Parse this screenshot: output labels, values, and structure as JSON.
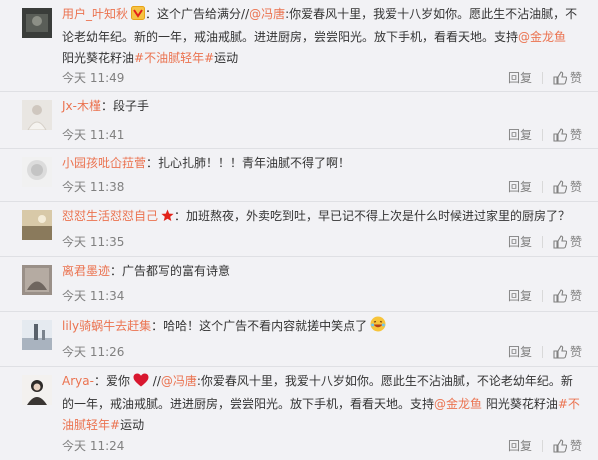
{
  "comments": [
    {
      "user": "用户_叶知秋",
      "separator": "：",
      "segments": [
        {
          "t": "这个广告给满分//",
          "k": "text"
        },
        {
          "t": "@冯唐",
          "k": "link"
        },
        {
          "t": ":你爱春风十里，我爱十八岁如你。愿此生不沾油腻，不论老幼年纪。新的一年，戒油戒腻。进进厨房，尝尝阳光。放下手机，看看天地。支持",
          "k": "text"
        },
        {
          "t": "@金龙鱼",
          "k": "link"
        },
        {
          "t": " 阳光葵花籽油",
          "k": "text"
        },
        {
          "t": "#不油腻轻年#",
          "k": "link"
        },
        {
          "t": "运动",
          "k": "text"
        }
      ],
      "time": "今天 11:49",
      "reply": "回复",
      "like": "赞"
    },
    {
      "user": "Jx-木槿",
      "separator": "：",
      "segments": [
        {
          "t": "段子手",
          "k": "text"
        }
      ],
      "time": "今天 11:41",
      "reply": "回复",
      "like": "赞"
    },
    {
      "user": "小园孩吡仚菈菅",
      "separator": "：",
      "segments": [
        {
          "t": "扎心扎肺！！！青年油腻不得了啊！",
          "k": "text"
        }
      ],
      "time": "今天 11:38",
      "reply": "回复",
      "like": "赞"
    },
    {
      "user": "怼怼生活怼怼自己",
      "separator": "：",
      "segments": [
        {
          "t": "加班熬夜，外卖吃到吐，早已记不得上次是什么时候进过家里的厨房了？",
          "k": "text"
        }
      ],
      "time": "今天 11:35",
      "reply": "回复",
      "like": "赞"
    },
    {
      "user": "离君墨迹",
      "separator": "：",
      "segments": [
        {
          "t": "广告都写的富有诗意",
          "k": "text"
        }
      ],
      "time": "今天 11:34",
      "reply": "回复",
      "like": "赞"
    },
    {
      "user": "lily骑蜗牛去赶集",
      "separator": "：",
      "segments": [
        {
          "t": "哈哈！这个广告不看内容就搓中笑点了",
          "k": "text"
        }
      ],
      "time": "今天 11:26",
      "reply": "回复",
      "like": "赞"
    },
    {
      "user": "Arya-",
      "separator": "：",
      "segments": [
        {
          "t": "爱你",
          "k": "text"
        },
        {
          "t": " //",
          "k": "text"
        },
        {
          "t": "@冯唐",
          "k": "link"
        },
        {
          "t": ":你爱春风十里，我爱十八岁如你。愿此生不沾油腻，不论老幼年纪。新的一年，戒油戒腻。进进厨房，尝尝阳光。放下手机，看看天地。支持",
          "k": "text"
        },
        {
          "t": "@金龙鱼",
          "k": "link"
        },
        {
          "t": " 阳光葵花籽油",
          "k": "text"
        },
        {
          "t": "#不油腻轻年#",
          "k": "link"
        },
        {
          "t": "运动",
          "k": "text"
        }
      ],
      "time": "今天 11:24",
      "reply": "回复",
      "like": "赞"
    }
  ],
  "colors": {
    "accent": "#eb7350",
    "text": "#333333",
    "meta": "#808080",
    "background": "#f2f2f5"
  },
  "icons": [
    "thumbs-up-icon",
    "vip-badge-icon",
    "star-icon",
    "heart-icon",
    "laughing-emoji-icon"
  ]
}
